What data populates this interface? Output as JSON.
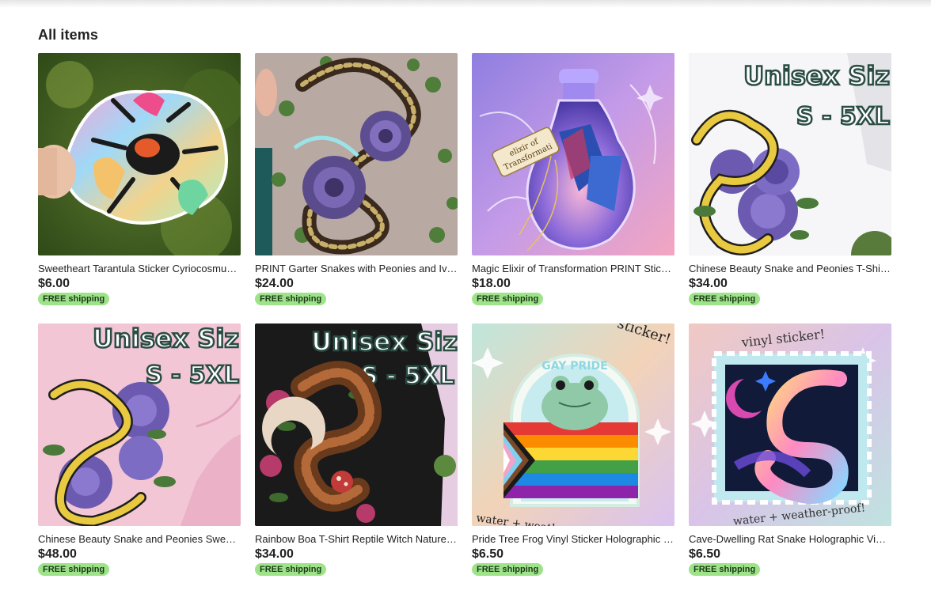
{
  "section": {
    "title": "All items"
  },
  "items": [
    {
      "title": "Sweetheart Tarantula Sticker Cyriocosmus Elegans | Holographic Waterproof",
      "price": "$6.00",
      "shipping": "FREE shipping",
      "image": "tarantula-sticker-photo"
    },
    {
      "title": "PRINT Garter Snakes with Peonies and Ivy Art Print",
      "price": "$24.00",
      "shipping": "FREE shipping",
      "image": "garter-snakes-print"
    },
    {
      "title": "Magic Elixir of Transformation PRINT Sticker Butterfly Potion",
      "price": "$18.00",
      "shipping": "FREE shipping",
      "image": "elixir-potion-print"
    },
    {
      "title": "Chinese Beauty Snake and Peonies T-Shirt Unisex",
      "price": "$34.00",
      "shipping": "FREE shipping",
      "image": "snake-peonies-tshirt-white"
    },
    {
      "title": "Chinese Beauty Snake and Peonies Sweatshirt Unisex",
      "price": "$48.00",
      "shipping": "FREE shipping",
      "image": "snake-peonies-sweatshirt-pink"
    },
    {
      "title": "Rainbow Boa T-Shirt Reptile Witch Nature Mushrooms",
      "price": "$34.00",
      "shipping": "FREE shipping",
      "image": "rainbow-boa-tshirt-black"
    },
    {
      "title": "Pride Tree Frog Vinyl Sticker Holographic Rainbow Flag",
      "price": "$6.50",
      "shipping": "FREE shipping",
      "image": "pride-frog-sticker"
    },
    {
      "title": "Cave-Dwelling Rat Snake Holographic Vinyl Sticker Stamp",
      "price": "$6.50",
      "shipping": "FREE shipping",
      "image": "rat-snake-stamp-sticker"
    }
  ],
  "image_text": {
    "unisex_line1": "Unisex Siz",
    "unisex_line2": "S - 5XL",
    "elixir_tag_line1": "elixir of",
    "elixir_tag_line2": "Transformati",
    "frog_top": "GAY PRIDE",
    "frog_corner": "sticker!",
    "frog_bottom": "water + weathe",
    "stamp_top": "vinyl sticker!",
    "stamp_bottom": "water + weather-proof!"
  },
  "colors": {
    "shipping_badge_bg": "#9ee38a",
    "shipping_badge_text": "#1c3a18",
    "text": "#222222"
  }
}
